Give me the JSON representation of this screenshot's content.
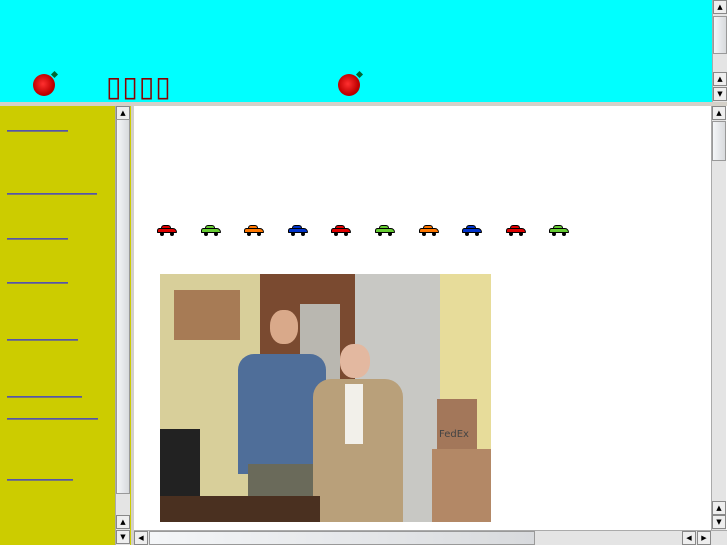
{
  "top_frame": {
    "title": "▯▯▯▯",
    "decorations": [
      "rose-icon",
      "rose-icon"
    ],
    "background": "#00ffff"
  },
  "sidebar": {
    "background": "#cccc00",
    "link_count": 8
  },
  "main": {
    "cars": [
      "#e00000",
      "#66cc33",
      "#ff7700",
      "#0033cc",
      "#e00000",
      "#66cc33",
      "#ff7700",
      "#0033cc",
      "#e00000",
      "#66cc33"
    ],
    "photo": {
      "box_label": "FedEx"
    }
  },
  "scrollbars": {
    "up": "▲",
    "down": "▼",
    "left": "◀",
    "right": "▶"
  }
}
